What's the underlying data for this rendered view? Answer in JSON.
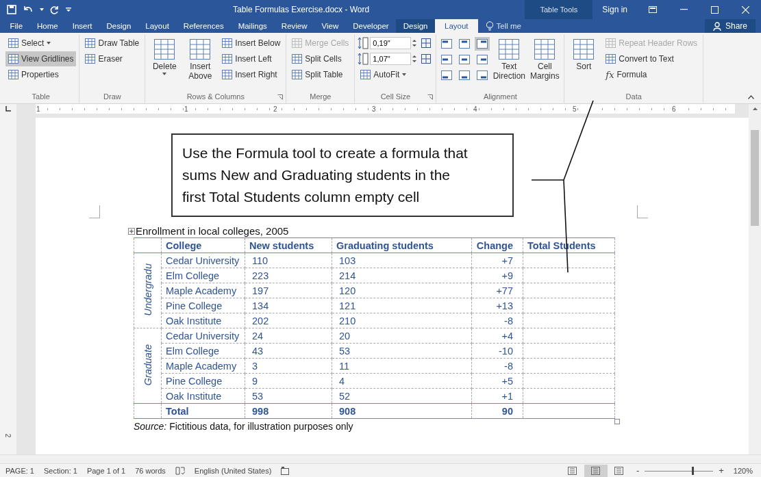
{
  "title_bar": {
    "title": "Table Formulas Exercise.docx - Word",
    "context_label": "Table Tools",
    "sign_in": "Sign in"
  },
  "menu_tabs": [
    {
      "label": "File",
      "kind": "main",
      "selected": false
    },
    {
      "label": "Home",
      "kind": "main",
      "selected": false
    },
    {
      "label": "Insert",
      "kind": "main",
      "selected": false
    },
    {
      "label": "Design",
      "kind": "main",
      "selected": false
    },
    {
      "label": "Layout",
      "kind": "main",
      "selected": false
    },
    {
      "label": "References",
      "kind": "main",
      "selected": false
    },
    {
      "label": "Mailings",
      "kind": "main",
      "selected": false
    },
    {
      "label": "Review",
      "kind": "main",
      "selected": false
    },
    {
      "label": "View",
      "kind": "main",
      "selected": false
    },
    {
      "label": "Developer",
      "kind": "main",
      "selected": false
    },
    {
      "label": "Design",
      "kind": "contextual",
      "selected": false
    },
    {
      "label": "Layout",
      "kind": "contextual",
      "selected": true
    }
  ],
  "tell_me": "Tell me",
  "share": "Share",
  "ribbon": {
    "groups": [
      {
        "label": "Table",
        "launcher": false,
        "columns": [
          [
            {
              "kind": "small",
              "label": "Select",
              "dropdown": true,
              "selected": false,
              "disabled": false
            },
            {
              "kind": "small",
              "label": "View Gridlines",
              "dropdown": false,
              "selected": true,
              "disabled": false
            },
            {
              "kind": "small",
              "label": "Properties",
              "dropdown": false,
              "selected": false,
              "disabled": false
            }
          ]
        ]
      },
      {
        "label": "Draw",
        "launcher": false,
        "columns": [
          [
            {
              "kind": "small",
              "label": "Draw Table",
              "dropdown": false,
              "selected": false,
              "disabled": false
            },
            {
              "kind": "small",
              "label": "Eraser",
              "dropdown": false,
              "selected": false,
              "disabled": false
            }
          ]
        ]
      },
      {
        "label": "Rows & Columns",
        "launcher": true,
        "columns": [
          [
            {
              "kind": "large",
              "label": "Delete",
              "dropdown": true,
              "selected": false,
              "disabled": false
            }
          ],
          [
            {
              "kind": "large",
              "label": "Insert Above",
              "dropdown": false,
              "selected": false,
              "disabled": false
            }
          ],
          [
            {
              "kind": "small",
              "label": "Insert Below",
              "dropdown": false,
              "selected": false,
              "disabled": false
            },
            {
              "kind": "small",
              "label": "Insert Left",
              "dropdown": false,
              "selected": false,
              "disabled": false
            },
            {
              "kind": "small",
              "label": "Insert Right",
              "dropdown": false,
              "selected": false,
              "disabled": false
            }
          ]
        ]
      },
      {
        "label": "Merge",
        "launcher": false,
        "columns": [
          [
            {
              "kind": "small",
              "label": "Merge Cells",
              "dropdown": false,
              "selected": false,
              "disabled": true
            },
            {
              "kind": "small",
              "label": "Split Cells",
              "dropdown": false,
              "selected": false,
              "disabled": false
            },
            {
              "kind": "small",
              "label": "Split Table",
              "dropdown": false,
              "selected": false,
              "disabled": false
            }
          ]
        ]
      },
      {
        "label": "Cell Size",
        "launcher": true,
        "columns": [
          [
            {
              "kind": "spin",
              "value": "0,19\""
            },
            {
              "kind": "spin",
              "value": "1,07\""
            },
            {
              "kind": "small",
              "label": "AutoFit",
              "dropdown": true,
              "selected": false,
              "disabled": false
            }
          ],
          [
            {
              "kind": "icon",
              "selected": false
            },
            {
              "kind": "icon",
              "selected": false
            }
          ]
        ]
      },
      {
        "label": "Alignment",
        "launcher": false,
        "columns": [
          [
            {
              "kind": "align",
              "selected": false
            },
            {
              "kind": "align",
              "selected": false
            },
            {
              "kind": "align",
              "selected": false
            }
          ],
          [
            {
              "kind": "align",
              "selected": false
            },
            {
              "kind": "align",
              "selected": false
            },
            {
              "kind": "align",
              "selected": false
            }
          ],
          [
            {
              "kind": "align",
              "selected": true
            },
            {
              "kind": "align",
              "selected": false
            },
            {
              "kind": "align",
              "selected": false
            }
          ],
          [
            {
              "kind": "large",
              "label": "Text Direction",
              "dropdown": false,
              "selected": false,
              "disabled": false
            }
          ],
          [
            {
              "kind": "large",
              "label": "Cell Margins",
              "dropdown": false,
              "selected": false,
              "disabled": false
            }
          ]
        ]
      },
      {
        "label": "Data",
        "launcher": false,
        "columns": [
          [
            {
              "kind": "large",
              "label": "Sort",
              "dropdown": false,
              "selected": false,
              "disabled": false
            }
          ],
          [
            {
              "kind": "small",
              "label": "Repeat Header Rows",
              "dropdown": false,
              "selected": false,
              "disabled": true
            },
            {
              "kind": "small",
              "label": "Convert to Text",
              "dropdown": false,
              "selected": false,
              "disabled": false
            },
            {
              "kind": "small",
              "label": "Formula",
              "glyph": "fx",
              "dropdown": false,
              "selected": false,
              "disabled": false
            }
          ]
        ]
      }
    ]
  },
  "ruler": {
    "marks": [
      "1",
      "1",
      "2",
      "3",
      "4",
      "5",
      "6"
    ]
  },
  "vertical_ruler": {
    "marks": [
      "2"
    ]
  },
  "document": {
    "callout": "Use the Formula tool to create a formula that sums New and Graduating students in the first Total Students column empty cell",
    "table": {
      "caption": "Enrollment in local colleges, 2005",
      "columns": [
        "College",
        "New students",
        "Graduating students",
        "Change",
        "Total Students"
      ],
      "groups": [
        {
          "label": "Undergradu",
          "rows": [
            {
              "college": "Cedar University",
              "new": "110",
              "graduating": "103",
              "change": "+7"
            },
            {
              "college": "Elm College",
              "new": "223",
              "graduating": "214",
              "change": "+9"
            },
            {
              "college": "Maple Academy",
              "new": "197",
              "graduating": "120",
              "change": "+77"
            },
            {
              "college": "Pine College",
              "new": "134",
              "graduating": "121",
              "change": "+13"
            },
            {
              "college": "Oak Institute",
              "new": "202",
              "graduating": "210",
              "change": "-8"
            }
          ]
        },
        {
          "label": "Graduate",
          "rows": [
            {
              "college": "Cedar University",
              "new": "24",
              "graduating": "20",
              "change": "+4"
            },
            {
              "college": "Elm College",
              "new": "43",
              "graduating": "53",
              "change": "-10"
            },
            {
              "college": "Maple Academy",
              "new": "3",
              "graduating": "11",
              "change": "-8"
            },
            {
              "college": "Pine College",
              "new": "9",
              "graduating": "4",
              "change": "+5"
            },
            {
              "college": "Oak Institute",
              "new": "53",
              "graduating": "52",
              "change": "+1"
            }
          ]
        }
      ],
      "total": {
        "label": "Total",
        "new": "998",
        "graduating": "908",
        "change": "90"
      }
    },
    "source": "*Source:* Fictitious data, for illustration purposes only"
  },
  "status_bar": {
    "page": "PAGE: 1",
    "section": "Section: 1",
    "pages": "Page 1 of 1",
    "words": "76 words",
    "language": "English (United States)",
    "views": [
      {
        "selected": false
      },
      {
        "selected": true
      },
      {
        "selected": false
      }
    ],
    "zoom": {
      "minus": "-",
      "plus": "+",
      "level": 0.7,
      "value": "120%"
    }
  }
}
